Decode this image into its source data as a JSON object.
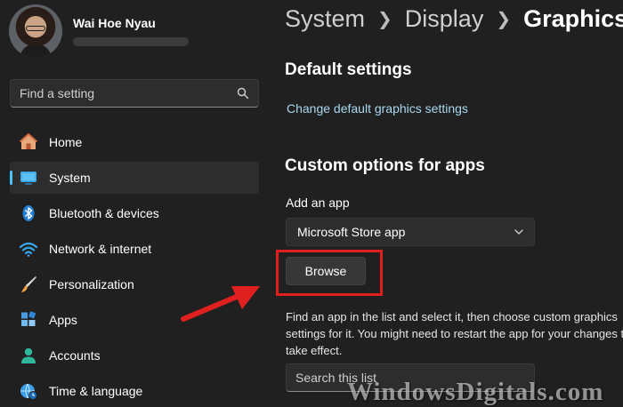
{
  "profile": {
    "name": "Wai Hoe Nyau"
  },
  "sidebar": {
    "search_placeholder": "Find a setting",
    "items": [
      {
        "label": "Home",
        "icon": "home-icon"
      },
      {
        "label": "System",
        "icon": "system-icon",
        "active": true
      },
      {
        "label": "Bluetooth & devices",
        "icon": "bluetooth-icon"
      },
      {
        "label": "Network & internet",
        "icon": "wifi-icon"
      },
      {
        "label": "Personalization",
        "icon": "brush-icon"
      },
      {
        "label": "Apps",
        "icon": "apps-icon"
      },
      {
        "label": "Accounts",
        "icon": "accounts-icon"
      },
      {
        "label": "Time & language",
        "icon": "globe-clock-icon"
      }
    ]
  },
  "breadcrumb": [
    "System",
    "Display",
    "Graphics"
  ],
  "default_settings": {
    "title": "Default settings",
    "link": "Change default graphics settings"
  },
  "custom_options": {
    "title": "Custom options for apps",
    "add_app_label": "Add an app",
    "dropdown_value": "Microsoft Store app",
    "browse_label": "Browse",
    "description": "Find an app in the list and select it, then choose custom graphics settings for it. You might need to restart the app for your changes to take effect.",
    "search_placeholder": "Search this list"
  },
  "watermark": "WindowsDigitals.com",
  "colors": {
    "background": "#202020",
    "accent": "#4cc2ff",
    "link": "#a8d8f0",
    "highlight": "#e0201e"
  }
}
